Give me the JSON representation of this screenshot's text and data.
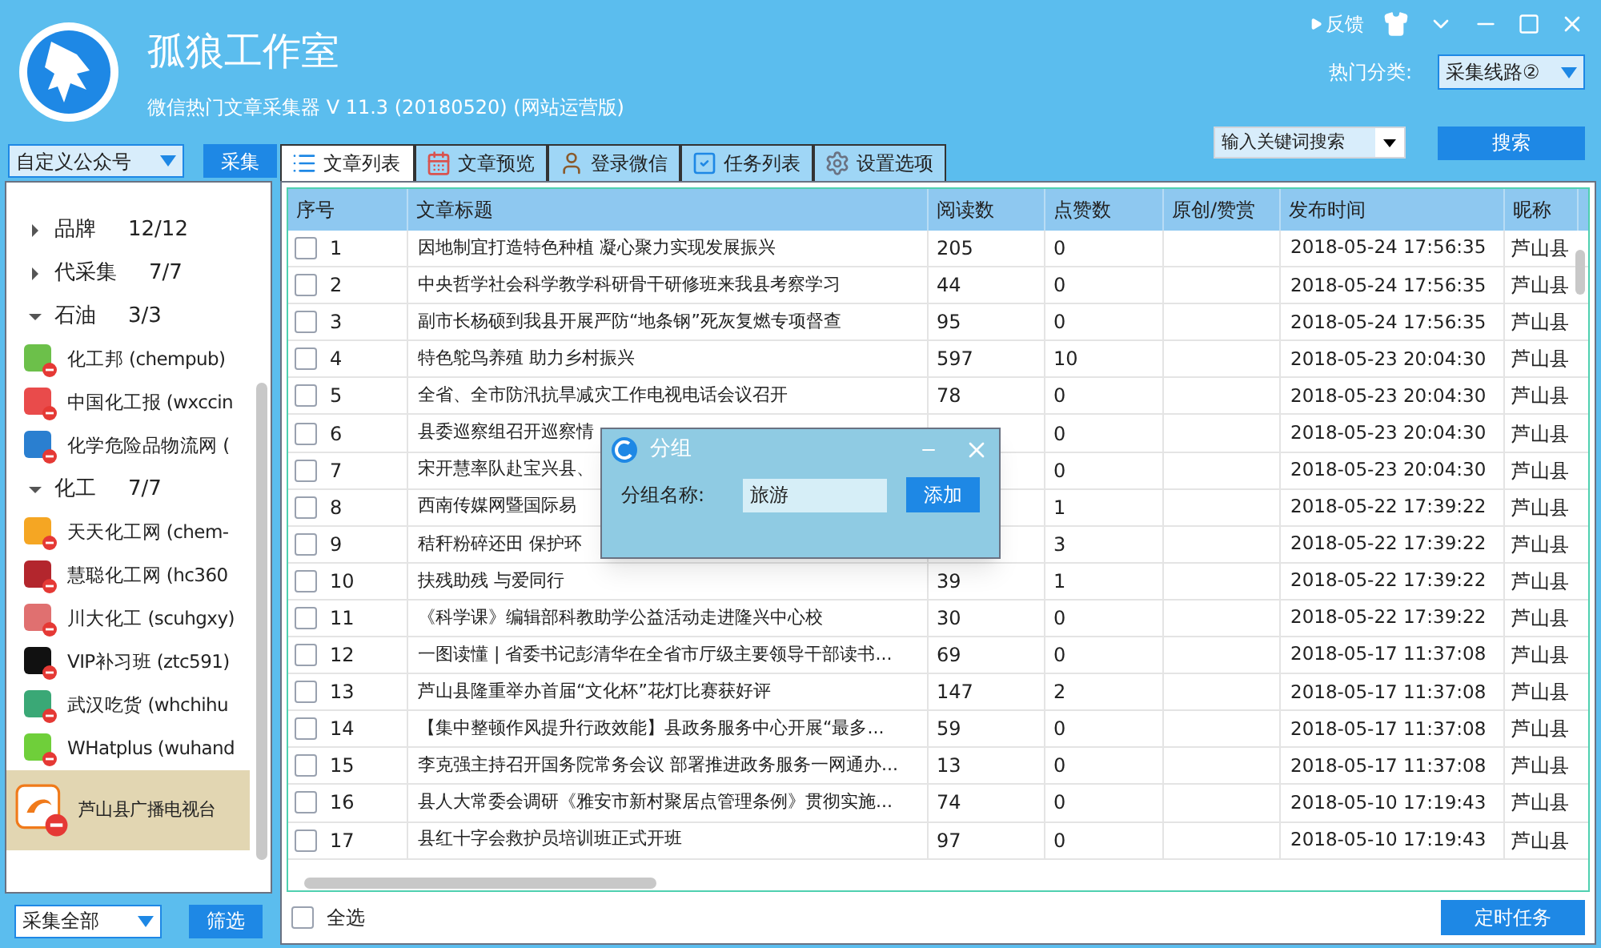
{
  "app": {
    "title": "孤狼工作室",
    "subtitle": "微信热门文章采集器  V 11.3 (20180520) (网站运营版)"
  },
  "topbar": {
    "feedback": "反馈",
    "category_label": "热门分类:",
    "category_value": "采集线路②",
    "search_placeholder": "输入关键词搜索",
    "search_button": "搜索"
  },
  "sidebar": {
    "account_type": "自定义公众号",
    "collect_button": "采集",
    "tree": [
      {
        "label": "品牌",
        "count": "12/12",
        "expanded": false
      },
      {
        "label": "代采集",
        "count": "7/7",
        "expanded": false
      },
      {
        "label": "石油",
        "count": "3/3",
        "expanded": true,
        "children": [
          {
            "label": "化工邦 (chempub)",
            "color": "#6cc04a",
            "selected": false
          },
          {
            "label": "中国化工报 (wxccin",
            "color": "#e94b4b",
            "selected": false
          },
          {
            "label": "化学危险品物流网 (",
            "color": "#2a7fd0",
            "selected": false
          }
        ]
      },
      {
        "label": "化工",
        "count": "7/7",
        "expanded": true,
        "children": [
          {
            "label": "天天化工网 (chem-",
            "color": "#f5a623",
            "selected": false
          },
          {
            "label": "慧聪化工网 (hc360",
            "color": "#b3262d",
            "selected": false
          },
          {
            "label": "川大化工 (scuhgxy)",
            "color": "#e07070",
            "selected": false
          },
          {
            "label": "VIP补习班 (ztc591)",
            "color": "#111111",
            "selected": false
          },
          {
            "label": "武汉吃货 (whchihu",
            "color": "#3aa876",
            "selected": false
          },
          {
            "label": "WHatplus (wuhand",
            "color": "#6fcf3a",
            "selected": false
          },
          {
            "label": "芦山县广播电视台",
            "color": "#f07a1a",
            "selected": true
          }
        ]
      }
    ],
    "filter_value": "采集全部",
    "filter_button": "筛选"
  },
  "tabs": [
    {
      "label": "文章列表",
      "selected": true
    },
    {
      "label": "文章预览",
      "selected": false
    },
    {
      "label": "登录微信",
      "selected": false
    },
    {
      "label": "任务列表",
      "selected": false
    },
    {
      "label": "设置选项",
      "selected": false
    }
  ],
  "table": {
    "columns": [
      "序号",
      "文章标题",
      "阅读数",
      "点赞数",
      "原创/赞赏",
      "发布时间",
      "昵称"
    ],
    "rows": [
      {
        "checked": false,
        "no": "1",
        "title": "因地制宜打造特色种植 凝心聚力实现发展振兴",
        "reads": "205",
        "likes": "0",
        "time": "2018-05-24 17:56:35",
        "nick": "芦山县"
      },
      {
        "checked": false,
        "no": "2",
        "title": "中央哲学社会科学教学科研骨干研修班来我县考察学习",
        "reads": "44",
        "likes": "0",
        "time": "2018-05-24 17:56:35",
        "nick": "芦山县"
      },
      {
        "checked": false,
        "no": "3",
        "title": "副市长杨硕到我县开展严防“地条钢”死灰复燃专项督查",
        "reads": "95",
        "likes": "0",
        "time": "2018-05-24 17:56:35",
        "nick": "芦山县"
      },
      {
        "checked": false,
        "no": "4",
        "title": "特色鸵鸟养殖 助力乡村振兴",
        "reads": "597",
        "likes": "10",
        "time": "2018-05-23 20:04:30",
        "nick": "芦山县"
      },
      {
        "checked": false,
        "no": "5",
        "title": "全省、全市防汛抗旱减灾工作电视电话会议召开",
        "reads": "78",
        "likes": "0",
        "time": "2018-05-23 20:04:30",
        "nick": "芦山县"
      },
      {
        "checked": false,
        "no": "6",
        "title": "县委巡察组召开巡察情",
        "likes": "0",
        "time": "2018-05-23 20:04:30",
        "nick": "芦山县"
      },
      {
        "checked": false,
        "no": "7",
        "title": "宋开慧率队赴宝兴县、",
        "likes": "0",
        "time": "2018-05-23 20:04:30",
        "nick": "芦山县"
      },
      {
        "checked": false,
        "no": "8",
        "title": "西南传媒网暨国际易",
        "likes": "1",
        "time": "2018-05-22 17:39:22",
        "nick": "芦山县"
      },
      {
        "checked": false,
        "no": "9",
        "title": "秸秆粉碎还田 保护环",
        "likes": "3",
        "time": "2018-05-22 17:39:22",
        "nick": "芦山县"
      },
      {
        "checked": false,
        "no": "10",
        "title": "扶残助残 与爱同行",
        "reads": "39",
        "likes": "1",
        "time": "2018-05-22 17:39:22",
        "nick": "芦山县"
      },
      {
        "checked": false,
        "no": "11",
        "title": "《科学课》编辑部科教助学公益活动走进隆兴中心校",
        "reads": "30",
        "likes": "0",
        "time": "2018-05-22 17:39:22",
        "nick": "芦山县"
      },
      {
        "checked": false,
        "no": "12",
        "title": "一图读懂 | 省委书记彭清华在全省市厅级主要领导干部读书...",
        "reads": "69",
        "likes": "0",
        "time": "2018-05-17 11:37:08",
        "nick": "芦山县"
      },
      {
        "checked": false,
        "no": "13",
        "title": "芦山县隆重举办首届“文化杯”花灯比赛获好评",
        "reads": "147",
        "likes": "2",
        "time": "2018-05-17 11:37:08",
        "nick": "芦山县"
      },
      {
        "checked": false,
        "no": "14",
        "title": "【集中整顿作风提升行政效能】县政务服务中心开展“最多...",
        "reads": "59",
        "likes": "0",
        "time": "2018-05-17 11:37:08",
        "nick": "芦山县"
      },
      {
        "checked": false,
        "no": "15",
        "title": "李克强主持召开国务院常务会议 部署推进政务服务一网通办...",
        "reads": "13",
        "likes": "0",
        "time": "2018-05-17 11:37:08",
        "nick": "芦山县"
      },
      {
        "checked": false,
        "no": "16",
        "title": "县人大常委会调研《雅安市新村聚居点管理条例》贯彻实施...",
        "reads": "74",
        "likes": "0",
        "time": "2018-05-10 17:19:43",
        "nick": "芦山县"
      },
      {
        "checked": false,
        "no": "17",
        "title": "县红十字会救护员培训班正式开班",
        "reads": "97",
        "likes": "0",
        "time": "2018-05-10 17:19:43",
        "nick": "芦山县"
      }
    ]
  },
  "footer": {
    "select_all": "全选",
    "select_all_checked": false,
    "schedule_button": "定时任务"
  },
  "dialog": {
    "title": "分组",
    "field_label": "分组名称:",
    "field_value": "旅游",
    "add_button": "添加"
  }
}
